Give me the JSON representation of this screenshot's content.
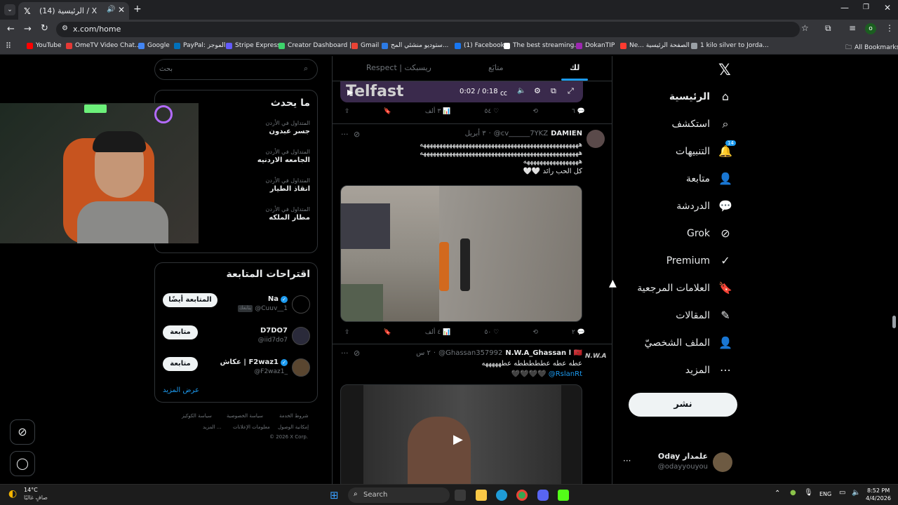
{
  "browser": {
    "tab_title": "(14) الرئيسية / X",
    "url": "x.com/home",
    "bookmarks": [
      {
        "label": "YouTube",
        "color": "#ff0000"
      },
      {
        "label": "OmeTV Video Chat...",
        "color": "#e53935"
      },
      {
        "label": "Google",
        "color": "#4285f4"
      },
      {
        "label": "PayPal: الموجز",
        "color": "#0070ba"
      },
      {
        "label": "Stripe Express",
        "color": "#635bff"
      },
      {
        "label": "Creator Dashboard |...",
        "color": "#3dd36b"
      },
      {
        "label": "Gmail",
        "color": "#ea4335"
      },
      {
        "label": "ستوديو منشئي المح...",
        "color": "#2c7be5"
      },
      {
        "label": "(1) Facebook",
        "color": "#1877f2"
      },
      {
        "label": "The best streaming...",
        "color": "#ffffff"
      },
      {
        "label": "DokanTIP",
        "color": "#9c27b0"
      },
      {
        "label": "Ne... الصفحة الرئيسية",
        "color": "#ff3b30"
      },
      {
        "label": "1 kilo silver to Jorda...",
        "color": "#9aa0a6"
      }
    ],
    "all_bookmarks": "All Bookmarks"
  },
  "nav": {
    "items": [
      {
        "label": "الرئيسية",
        "icon": "home-icon"
      },
      {
        "label": "استكشف",
        "icon": "search-icon"
      },
      {
        "label": "التنبيهات",
        "icon": "bell-icon",
        "badge": "14"
      },
      {
        "label": "متابعة",
        "icon": "add-user-icon"
      },
      {
        "label": "الدردشة",
        "icon": "chat-icon"
      },
      {
        "label": "Grok",
        "icon": "grok-icon"
      },
      {
        "label": "Premium",
        "icon": "premium-icon"
      },
      {
        "label": "العلامات المرجعية",
        "icon": "bookmark-icon"
      },
      {
        "label": "المقالات",
        "icon": "article-icon"
      },
      {
        "label": "الملف الشخصيّ",
        "icon": "profile-icon"
      },
      {
        "label": "المزيد",
        "icon": "more-icon"
      }
    ],
    "post_button": "نشر",
    "account": {
      "name": "Oday علمدار",
      "handle": "@odayyouyou"
    }
  },
  "timeline": {
    "tabs": [
      "لك",
      "متابَع",
      "Respect | ريسبكت"
    ],
    "video_overlay_text": "Telfast",
    "video_time": "0:02 / 0:18",
    "tweet0_actions": {
      "replies": "٦",
      "retweets": "",
      "likes": "٥٤",
      "views": "٣ ألف"
    },
    "tweet1": {
      "name": "DAMIEN",
      "handle": "@cv______7YKZ",
      "time": "٣ أبريل",
      "text_line1": "هههههههههههههههههههههههههههههههههههههههههههههههههه",
      "text_line2": "هههههههههههههههههههههههههههههههههههههههههههههههههه",
      "text_line3": "هههههههههههههههههه",
      "text_line4": "كل الحب رائد 🤍🤍",
      "actions": {
        "replies": "٢",
        "retweets": "",
        "likes": "٥٠",
        "views": "٤ ألف"
      }
    },
    "tweet2": {
      "name": "N.W.A_Ghassan l 🇲🇦",
      "handle": "@Ghassan357992",
      "time": "٢ س",
      "text_line1": "عطه عطه عطططططه عطهههههه",
      "mention": "@RslanRt",
      "hearts": "🖤🖤🖤🖤",
      "avatar_text": "N.W.A"
    }
  },
  "sidebar": {
    "search_placeholder": "بحث",
    "trending_title": "ما يحدث",
    "trends": [
      {
        "context": "المتداول في الأردن",
        "name": "جسر عبدون"
      },
      {
        "context": "المتداول في الأردن",
        "name": "الجامعه الاردنيه"
      },
      {
        "context": "المتداول في الأردن",
        "name": "انقاذ الطيار"
      },
      {
        "context": "المتداول في الأردن",
        "name": "مطار الملكه"
      }
    ],
    "suggestions_title": "اقتراحات المتابعة",
    "suggestions": [
      {
        "name": "Na",
        "handle": "@Cuuv__1",
        "follows_you": "يتابعك",
        "button": "المتابعة أيضًا",
        "verified": true
      },
      {
        "name": "D7DO7",
        "handle": "@iid7do7",
        "button": "متابعة",
        "verified": false
      },
      {
        "name": "عكاش | F2waz1",
        "handle": "@F2waz1_",
        "button": "متابعة",
        "verified": true
      }
    ],
    "show_more": "عرض المزيد",
    "footer": [
      "شروط الخدمة",
      "سياسة الخصوصية",
      "سياسة الكوكيز",
      "إمكانية الوصول",
      "معلومات الإعلانات",
      "المزيد ...",
      "© 2026 X Corp."
    ]
  },
  "taskbar": {
    "weather_temp": "14°C",
    "weather_desc": "صافٍ غالبًا",
    "search": "Search",
    "lang": "ENG",
    "time": "8:52 PM",
    "date": "4/4/2026"
  },
  "colors": {
    "accent": "#1d9bf0",
    "bg": "#000000",
    "border": "#2f3336"
  }
}
